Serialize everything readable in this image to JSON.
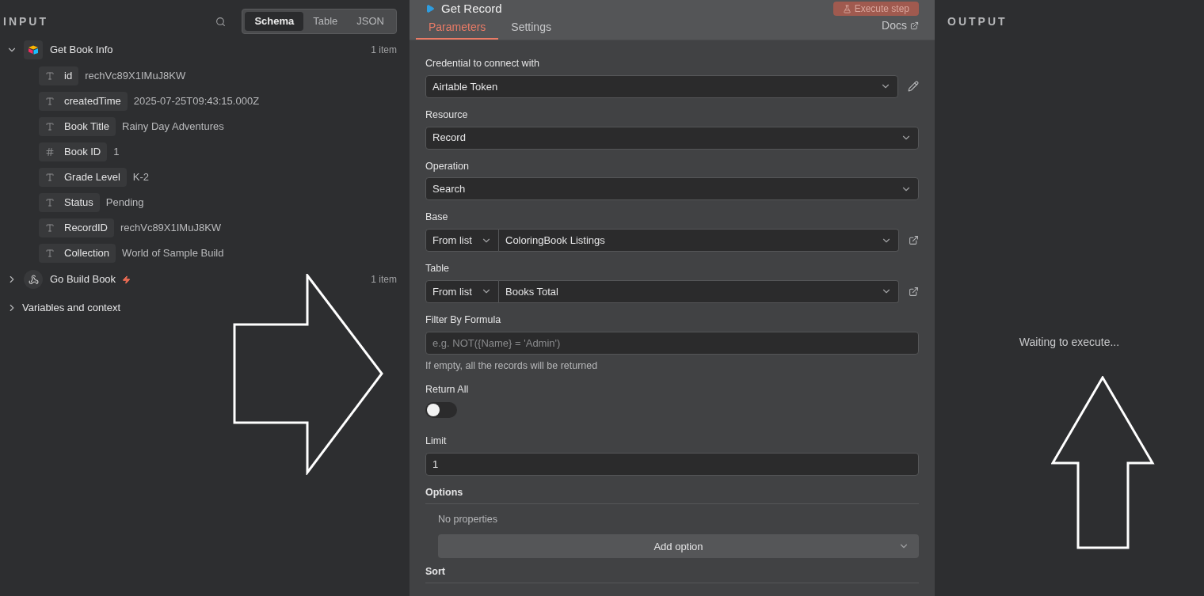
{
  "input": {
    "title": "INPUT",
    "views": [
      {
        "label": "Schema",
        "selected": true
      },
      {
        "label": "Table",
        "selected": false
      },
      {
        "label": "JSON",
        "selected": false
      }
    ],
    "nodes": [
      {
        "kind": "airtable",
        "name": "Get Book Info",
        "count": "1 item",
        "expanded": true,
        "trigger": false,
        "fields": [
          {
            "kind": "string",
            "name": "id",
            "value": "rechVc89X1IMuJ8KW"
          },
          {
            "kind": "string",
            "name": "createdTime",
            "value": "2025-07-25T09:43:15.000Z"
          },
          {
            "kind": "string",
            "name": "Book Title",
            "value": "Rainy Day Adventures"
          },
          {
            "kind": "number",
            "name": "Book ID",
            "value": "1"
          },
          {
            "kind": "string",
            "name": "Grade Level",
            "value": "K-2"
          },
          {
            "kind": "string",
            "name": "Status",
            "value": "Pending"
          },
          {
            "kind": "string",
            "name": "RecordID",
            "value": "rechVc89X1IMuJ8KW"
          },
          {
            "kind": "string",
            "name": "Collection",
            "value": "World of Sample Build"
          }
        ]
      },
      {
        "kind": "webhook",
        "name": "Go Build Book",
        "count": "1 item",
        "expanded": false,
        "trigger": true
      }
    ],
    "variables": {
      "label": "Variables and context",
      "expanded": false
    }
  },
  "node": {
    "title": "Get Record",
    "execute": {
      "label": "Execute step",
      "disabled": true
    },
    "tabs": [
      {
        "label": "Parameters",
        "selected": true
      },
      {
        "label": "Settings",
        "selected": false
      }
    ],
    "docs": "Docs",
    "params": [
      {
        "kind": "select",
        "label": "Credential to connect with",
        "value": "Airtable Token",
        "editable": true
      },
      {
        "kind": "select",
        "label": "Resource",
        "value": "Record",
        "editable": false
      },
      {
        "kind": "select",
        "label": "Operation",
        "value": "Search",
        "editable": false
      },
      {
        "kind": "locator",
        "label": "Base",
        "mode": "From list",
        "value": "ColoringBook Listings"
      },
      {
        "kind": "locator",
        "label": "Table",
        "mode": "From list",
        "value": "Books Total"
      },
      {
        "kind": "text",
        "label": "Filter By Formula",
        "placeholder": "e.g. NOT({Name} = 'Admin')",
        "hint": "If empty, all the records will be returned"
      },
      {
        "kind": "toggle",
        "label": "Return All",
        "on": false
      },
      {
        "kind": "text",
        "label": "Limit",
        "value": "1"
      },
      {
        "kind": "collection",
        "label": "Options",
        "empty": "No properties",
        "button": "Add option"
      },
      {
        "kind": "heading",
        "label": "Sort"
      }
    ]
  },
  "output": {
    "title": "OUTPUT",
    "message": "Waiting to execute..."
  }
}
